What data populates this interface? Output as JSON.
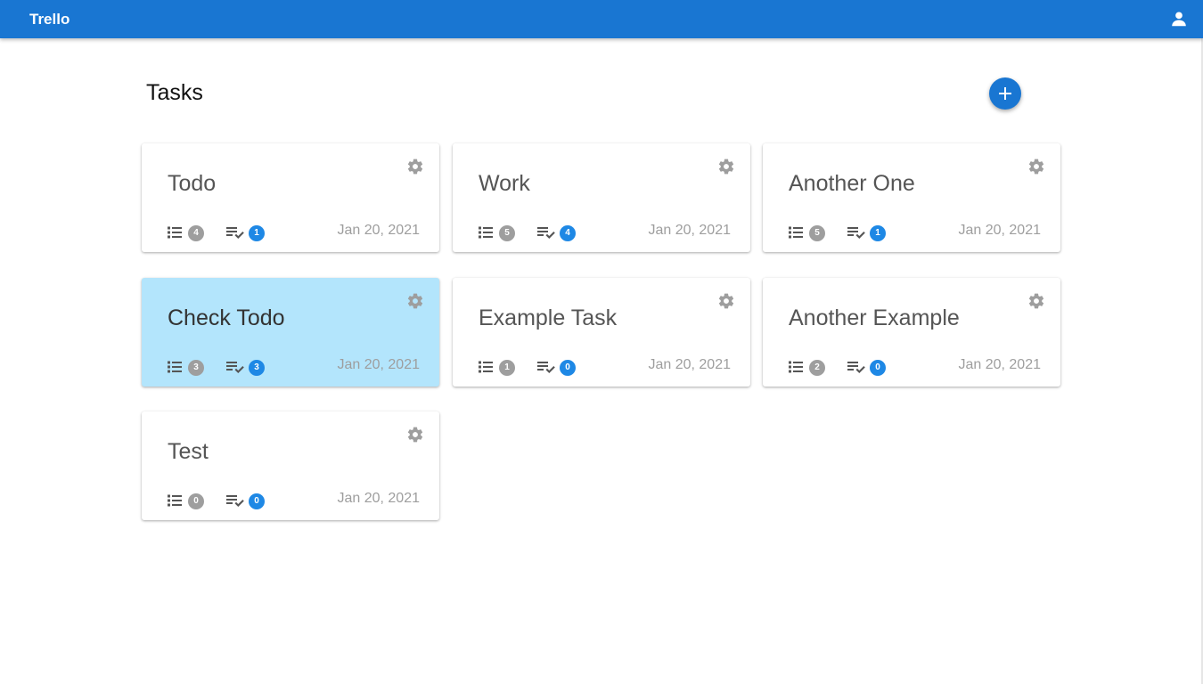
{
  "header": {
    "title": "Trello",
    "account_icon": "account-icon"
  },
  "page": {
    "title": "Tasks",
    "add_icon": "plus-icon"
  },
  "colors": {
    "primary": "#1976d2",
    "selected_card": "#b3e5fc",
    "list_badge": "#9e9e9e",
    "done_badge": "#1e88e5"
  },
  "cards": [
    {
      "title": "Todo",
      "lists": "4",
      "done": "1",
      "date": "Jan 20, 2021",
      "selected": false
    },
    {
      "title": "Work",
      "lists": "5",
      "done": "4",
      "date": "Jan 20, 2021",
      "selected": false
    },
    {
      "title": "Another One",
      "lists": "5",
      "done": "1",
      "date": "Jan 20, 2021",
      "selected": false
    },
    {
      "title": "Check Todo",
      "lists": "3",
      "done": "3",
      "date": "Jan 20, 2021",
      "selected": true
    },
    {
      "title": "Example Task",
      "lists": "1",
      "done": "0",
      "date": "Jan 20, 2021",
      "selected": false
    },
    {
      "title": "Another Example",
      "lists": "2",
      "done": "0",
      "date": "Jan 20, 2021",
      "selected": false
    },
    {
      "title": "Test",
      "lists": "0",
      "done": "0",
      "date": "Jan 20, 2021",
      "selected": false
    }
  ]
}
